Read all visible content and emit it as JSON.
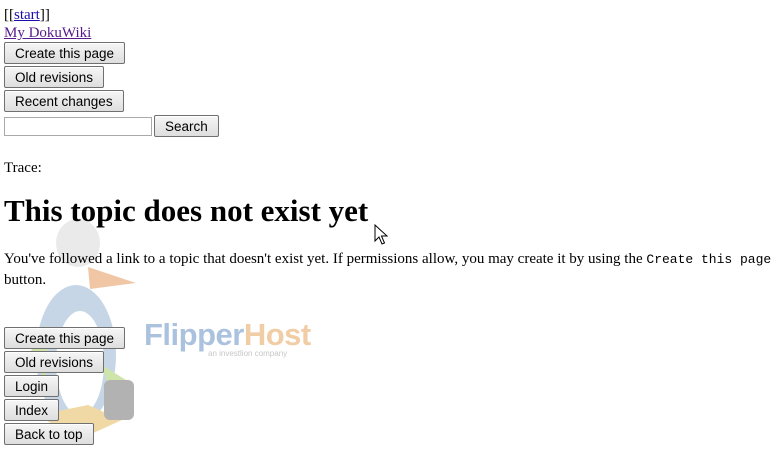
{
  "breadcrumb": {
    "prefix": "[[",
    "link": "start",
    "suffix": "]]"
  },
  "site_title": "My DokuWiki",
  "top_actions": {
    "create": "Create this page",
    "old_revisions": "Old revisions",
    "recent_changes": "Recent changes"
  },
  "search": {
    "value": "",
    "placeholder": "",
    "button": "Search"
  },
  "trace_label": "Trace:",
  "heading": "This topic does not exist yet",
  "message": {
    "before": "You've followed a link to a topic that doesn't exist yet. If permissions allow, you may create it by using the ",
    "code": "Create this page",
    "after": " button."
  },
  "bottom_actions": {
    "create": "Create this page",
    "old_revisions": "Old revisions",
    "login": "Login",
    "index": "Index",
    "back_to_top": "Back to top"
  },
  "watermark": {
    "brand_a": "Flipper",
    "brand_b": "Host",
    "tagline": "an investlion company"
  }
}
